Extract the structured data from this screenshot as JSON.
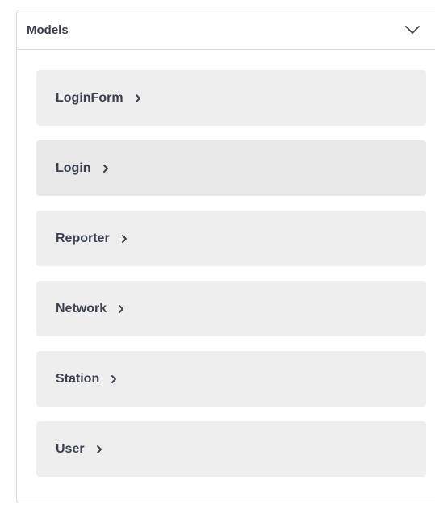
{
  "panel": {
    "title": "Models",
    "toggle_icon": "chevron-down-icon"
  },
  "models": [
    {
      "label": "LoginForm",
      "icon": "chevron-right-icon"
    },
    {
      "label": "Login",
      "icon": "chevron-right-icon"
    },
    {
      "label": "Reporter",
      "icon": "chevron-right-icon"
    },
    {
      "label": "Network",
      "icon": "chevron-right-icon"
    },
    {
      "label": "Station",
      "icon": "chevron-right-icon"
    },
    {
      "label": "User",
      "icon": "chevron-right-icon"
    }
  ],
  "colors": {
    "text": "#3b4151",
    "item_background": "#eeeeee",
    "border": "#d9d9d9"
  }
}
